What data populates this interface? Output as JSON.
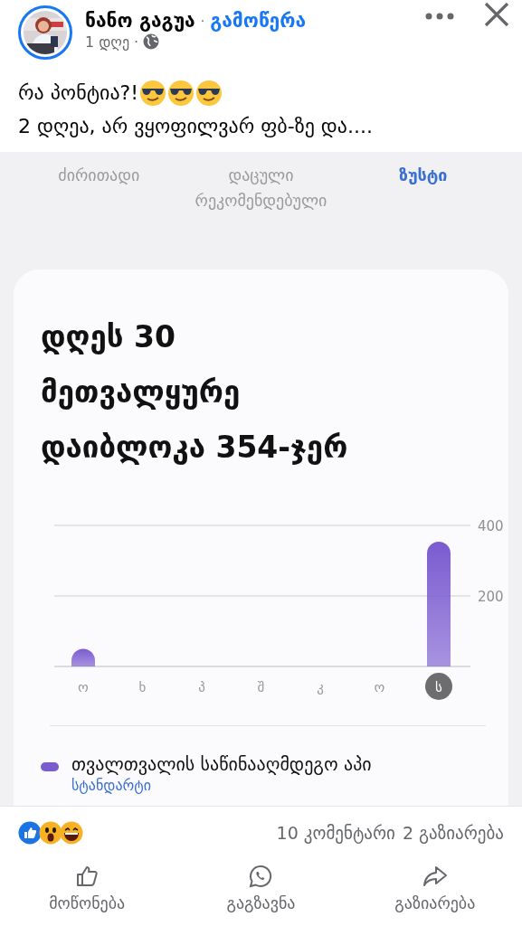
{
  "author": {
    "name": "ნანო გაგუა",
    "follow_link": "გამოწერა",
    "separator": "·",
    "time": "1 დღე"
  },
  "post_lines": [
    "რა პონტია?!",
    "2 დღეა, არ ვყოფილვარ ფბ-ზე და...."
  ],
  "screenshot": {
    "tabs": [
      {
        "label": "ძირითადი",
        "selected": false
      },
      {
        "label": "დაცული რეკომენდებული",
        "selected": false
      },
      {
        "label": "ზუსტი",
        "selected": true
      }
    ],
    "card": {
      "title_lines": [
        "დღეს 30",
        "მეთვალყურე",
        "დაიბლოკა 354-ჯერ"
      ],
      "chart_data": {
        "type": "bar",
        "categories": [
          "ო",
          "ხ",
          "პ",
          "შ",
          "კ",
          "ო",
          "ს"
        ],
        "series": [
          {
            "name": "თვალთვალის საწინააღმდეგო აპი",
            "color": "#7b5bd0",
            "values": [
              50,
              0,
              0,
              0,
              0,
              0,
              354
            ]
          }
        ],
        "ylim": [
          0,
          400
        ],
        "yticks": [
          200,
          400
        ]
      },
      "day_selected": [
        false,
        false,
        false,
        false,
        false,
        false,
        true
      ],
      "legend": {
        "color": "#7b5bd0",
        "link": "სტანდარტი"
      }
    }
  },
  "stats": {
    "comments": "10 კომენტარი",
    "shares": "2 გაზიარება"
  },
  "actions": [
    {
      "label": "მოწონება",
      "kind": "like"
    },
    {
      "label": "გაგზავნა",
      "kind": "whatsapp"
    },
    {
      "label": "გაზიარება",
      "kind": "share"
    }
  ]
}
